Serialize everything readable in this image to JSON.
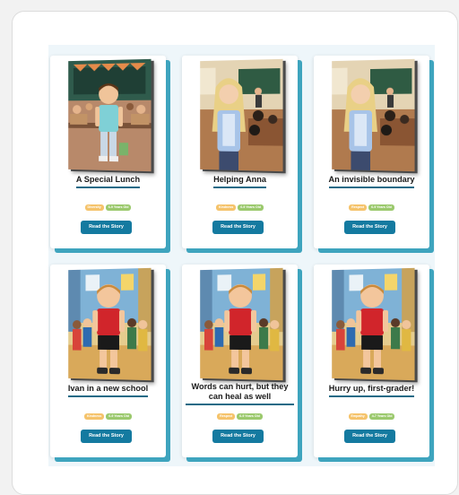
{
  "stories": [
    {
      "title": "A Special Lunch",
      "topic": "Diversity",
      "age": "6-9 Years Old",
      "button": "Read the Story",
      "cover": "classroom-boy"
    },
    {
      "title": "Helping Anna",
      "topic": "Kindness",
      "age": "6-9 Years Old",
      "button": "Read the Story",
      "cover": "classroom-girl"
    },
    {
      "title": "An invisible boundary",
      "topic": "Respect",
      "age": "6-9 Years Old",
      "button": "Read the Story",
      "cover": "classroom-girl"
    },
    {
      "title": "Ivan in a new school",
      "topic": "Kindness",
      "age": "6-9 Years Old",
      "button": "Read the Story",
      "cover": "hallway-boy"
    },
    {
      "title": "Words can hurt, but they can heal as well",
      "topic": "Respect",
      "age": "6-9 Years Old",
      "button": "Read the Story",
      "cover": "hallway-boy"
    },
    {
      "title": "Hurry up, first-grader!",
      "topic": "Empathy",
      "age": "4-7 Years Old",
      "button": "Read the Story",
      "cover": "hallway-boy"
    }
  ],
  "colors": {
    "accent": "#147aa0",
    "card_shadow": "#3ea4be",
    "topic_badge": "#f5c36b",
    "age_badge": "#9bc96d"
  }
}
